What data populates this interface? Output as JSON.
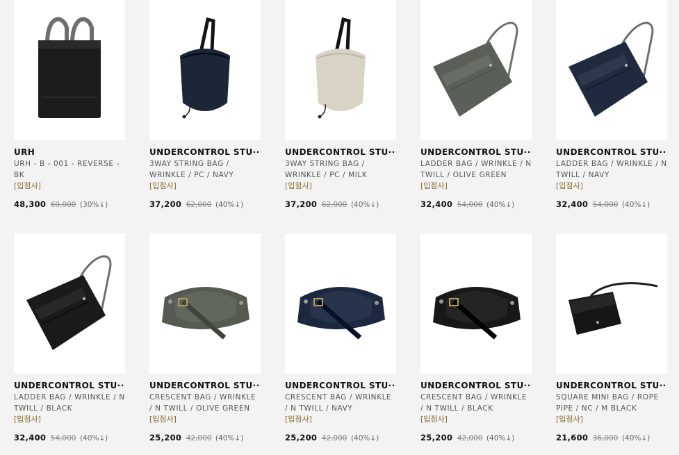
{
  "products": [
    {
      "brand": "URH",
      "name": "URH - B - 001 - REVERSE - BK",
      "tag": "[입점사]",
      "price": "48,300",
      "original": "69,000",
      "discount": "(30%↓)",
      "icon": "tote-bag-black",
      "color": "#1c1c1c"
    },
    {
      "brand": "UNDERCONTROL STU···",
      "name": "3WAY STRING BAG / WRINKLE / PC / NAVY",
      "tag": "[입점사]",
      "price": "37,200",
      "original": "62,000",
      "discount": "(40%↓)",
      "icon": "string-bag-navy",
      "color": "#1b2637"
    },
    {
      "brand": "UNDERCONTROL STU···",
      "name": "3WAY STRING BAG / WRINKLE / PC / MILK",
      "tag": "[입점사]",
      "price": "37,200",
      "original": "62,000",
      "discount": "(40%↓)",
      "icon": "string-bag-milk",
      "color": "#d9d3c6"
    },
    {
      "brand": "UNDERCONTROL STU···",
      "name": "LADDER BAG / WRINKLE / N TWILL / OLIVE GREEN",
      "tag": "[입점사]",
      "price": "32,400",
      "original": "54,000",
      "discount": "(40%↓)",
      "icon": "ladder-bag-olive",
      "color": "#5a5f58"
    },
    {
      "brand": "UNDERCONTROL STU···",
      "name": "LADDER BAG / WRINKLE / N TWILL / NAVY",
      "tag": "[입점사]",
      "price": "32,400",
      "original": "54,000",
      "discount": "(40%↓)",
      "icon": "ladder-bag-navy",
      "color": "#1f2a3f"
    },
    {
      "brand": "UNDERCONTROL STU···",
      "name": "LADDER BAG / WRINKLE / N TWILL / BLACK",
      "tag": "[입점사]",
      "price": "32,400",
      "original": "54,000",
      "discount": "(40%↓)",
      "icon": "ladder-bag-black",
      "color": "#1a1a1a"
    },
    {
      "brand": "UNDERCONTROL STU···",
      "name": "CRESCENT BAG / WRINKLE / N TWILL / OLIVE GREEN",
      "tag": "[입점사]",
      "price": "25,200",
      "original": "42,000",
      "discount": "(40%↓)",
      "icon": "crescent-bag-olive",
      "color": "#565b52"
    },
    {
      "brand": "UNDERCONTROL STU···",
      "name": "CRESCENT BAG / WRINKLE / N TWILL / NAVY",
      "tag": "[입점사]",
      "price": "25,200",
      "original": "42,000",
      "discount": "(40%↓)",
      "icon": "crescent-bag-navy",
      "color": "#1c2740"
    },
    {
      "brand": "UNDERCONTROL STU···",
      "name": "CRESCENT BAG / WRINKLE / N TWILL / BLACK",
      "tag": "[입점사]",
      "price": "25,200",
      "original": "42,000",
      "discount": "(40%↓)",
      "icon": "crescent-bag-black",
      "color": "#181818"
    },
    {
      "brand": "UNDERCONTROL STU···",
      "name": "SQUARE MINI BAG / ROPE PIPE / NC / M BLACK",
      "tag": "[입점사]",
      "price": "21,600",
      "original": "36,000",
      "discount": "(40%↓)",
      "icon": "square-mini-bag-black",
      "color": "#161616"
    }
  ]
}
